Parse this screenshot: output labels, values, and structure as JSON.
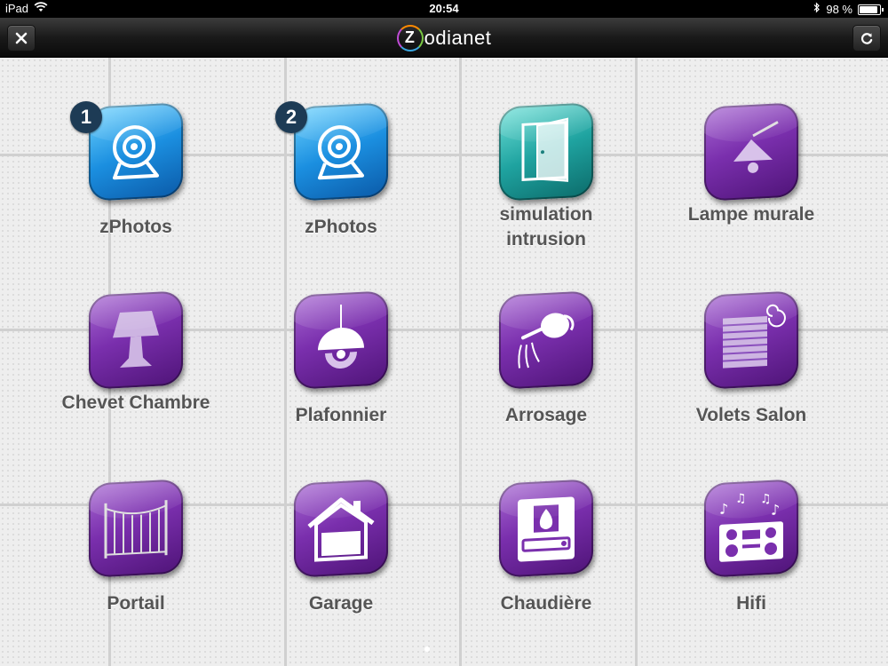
{
  "status_bar": {
    "device": "iPad",
    "time": "20:54",
    "battery_label": "98 %",
    "battery_level": 0.98
  },
  "nav": {
    "title": "odianet",
    "logo_letter": "Z",
    "close_icon": "close-icon",
    "refresh_icon": "refresh-icon"
  },
  "tiles": [
    {
      "label": "zPhotos",
      "badge": "1",
      "color": "blue",
      "icon": "webcam-icon"
    },
    {
      "label": "zPhotos",
      "badge": "2",
      "color": "blue",
      "icon": "webcam-icon"
    },
    {
      "label": "simulation intrusion",
      "color": "teal",
      "icon": "door-icon"
    },
    {
      "label": "Lampe murale",
      "color": "purple",
      "icon": "wall-lamp-icon"
    },
    {
      "label": "Chevet Chambre",
      "color": "purple",
      "icon": "bedside-lamp-icon"
    },
    {
      "label": "Plafonnier",
      "color": "purple",
      "icon": "ceiling-lamp-icon"
    },
    {
      "label": "Arrosage",
      "color": "purple",
      "icon": "watering-can-icon"
    },
    {
      "label": "Volets Salon",
      "color": "purple",
      "icon": "shutter-icon"
    },
    {
      "label": "Portail",
      "color": "purple",
      "icon": "gate-icon"
    },
    {
      "label": "Garage",
      "color": "purple",
      "icon": "garage-icon"
    },
    {
      "label": "Chaudière",
      "color": "purple",
      "icon": "boiler-icon"
    },
    {
      "label": "Hifi",
      "color": "purple",
      "icon": "hifi-icon"
    }
  ]
}
